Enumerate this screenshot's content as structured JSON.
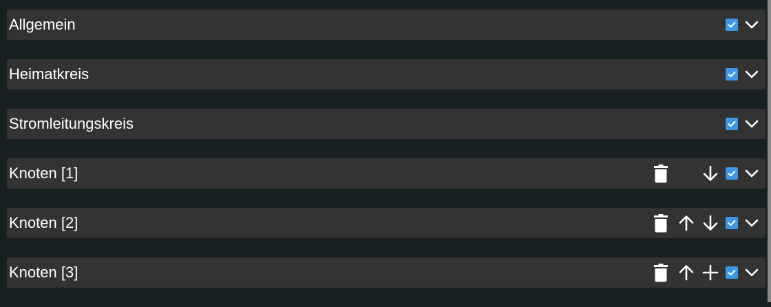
{
  "sections": [
    {
      "title": "Allgemein",
      "checked": true,
      "actions": []
    },
    {
      "title": "Heimatkreis",
      "checked": true,
      "actions": []
    },
    {
      "title": "Stromleitungskreis",
      "checked": true,
      "actions": []
    },
    {
      "title": "Knoten [1]",
      "checked": true,
      "actions": [
        "delete",
        "move-down"
      ]
    },
    {
      "title": "Knoten [2]",
      "checked": true,
      "actions": [
        "delete",
        "move-up",
        "move-down"
      ]
    },
    {
      "title": "Knoten [3]",
      "checked": true,
      "actions": [
        "delete",
        "move-up",
        "add"
      ]
    }
  ],
  "icons": {
    "delete": "trash-icon",
    "move-up": "arrow-up-icon",
    "move-down": "arrow-down-icon",
    "add": "plus-icon",
    "checkbox": "checkbox-checked-icon",
    "expand": "chevron-down-icon"
  },
  "colors": {
    "background": "#182022",
    "row": "#333333",
    "checkbox": "#3f97e3",
    "text": "#ffffff",
    "scrollbar_thumb": "#8a8a8a"
  }
}
